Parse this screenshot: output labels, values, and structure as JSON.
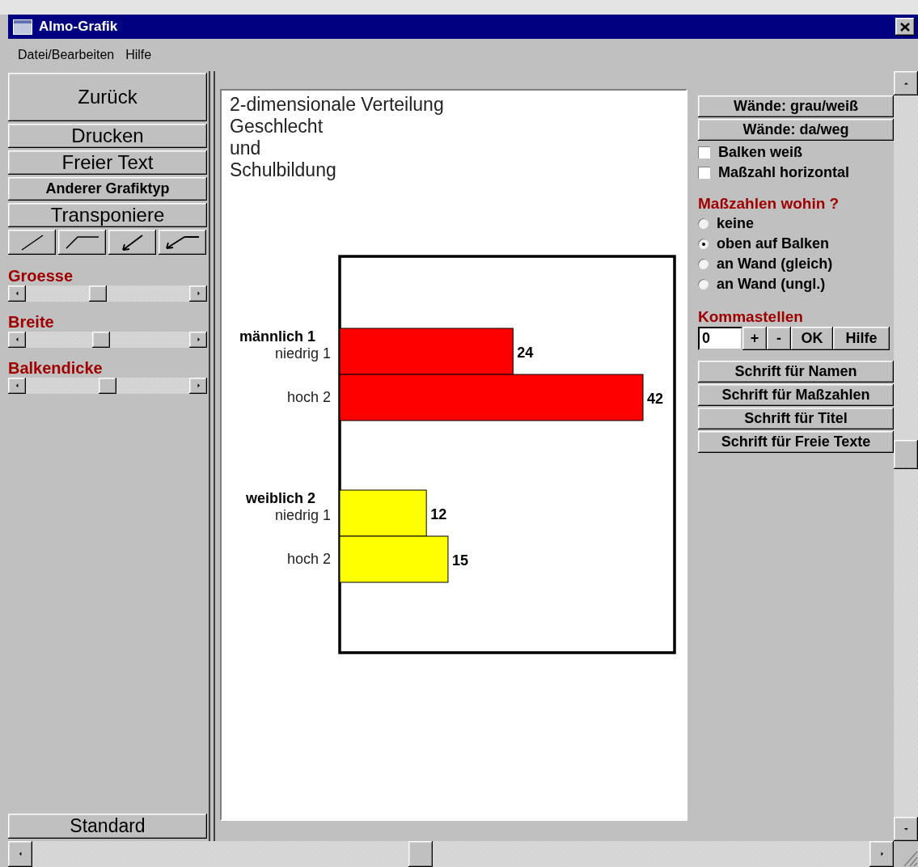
{
  "window": {
    "title": "Almo-Grafik"
  },
  "menu": [
    "Datei/Bearbeiten",
    "Hilfe"
  ],
  "left_panel": {
    "buttons": [
      {
        "label": "Zurück",
        "kind": "tall"
      },
      {
        "label": "Drucken",
        "kind": "plain"
      },
      {
        "label": "Freier Text",
        "kind": "plain"
      },
      {
        "label": "Anderer Grafiktyp",
        "kind": "bold"
      },
      {
        "label": "Transponiere",
        "kind": "plain"
      }
    ],
    "sliders": [
      {
        "label": "Groesse",
        "level": 0.46
      },
      {
        "label": "Breite",
        "level": 0.48
      },
      {
        "label": "Balkendicke",
        "level": 0.53
      }
    ],
    "standard_button": "Standard"
  },
  "canvas": {
    "title_lines": [
      "2-dimensionale Verteilung",
      "Geschlecht",
      "und",
      "Schulbildung"
    ],
    "chart_data": {
      "type": "bar",
      "orientation": "horizontal",
      "categories": [
        "männlich 1",
        "weiblich 2"
      ],
      "data_labels": true,
      "series": [
        {
          "name": "niedrig 1",
          "colors": [
            "#ff0000",
            "#ffff00"
          ],
          "values": [
            24,
            12
          ]
        },
        {
          "name": "hoch 2",
          "colors": [
            "#ff0000",
            "#ffff00"
          ],
          "values": [
            42,
            15
          ]
        }
      ]
    }
  },
  "right_panel": {
    "wall_buttons": [
      "Wände: grau/weiß",
      "Wände: da/weg"
    ],
    "checkboxes": [
      {
        "label": "Balken weiß",
        "checked": false
      },
      {
        "label": "Maßzahl horizontal",
        "checked": false
      }
    ],
    "placement": {
      "heading": "Maßzahlen wohin ?",
      "options": [
        {
          "label": "keine",
          "selected": false
        },
        {
          "label": "oben auf Balken",
          "selected": true
        },
        {
          "label": "an Wand (gleich)",
          "selected": false
        },
        {
          "label": "an Wand (ungl.)",
          "selected": false
        }
      ]
    },
    "decimals": {
      "heading": "Kommastellen",
      "value": "0",
      "buttons": [
        "+",
        "-",
        "OK",
        "Hilfe"
      ]
    },
    "font_buttons": [
      "Schrift für Namen",
      "Schrift für Maßzahlen",
      "Schrift für Titel",
      "Schrift für Freie Texte"
    ]
  }
}
